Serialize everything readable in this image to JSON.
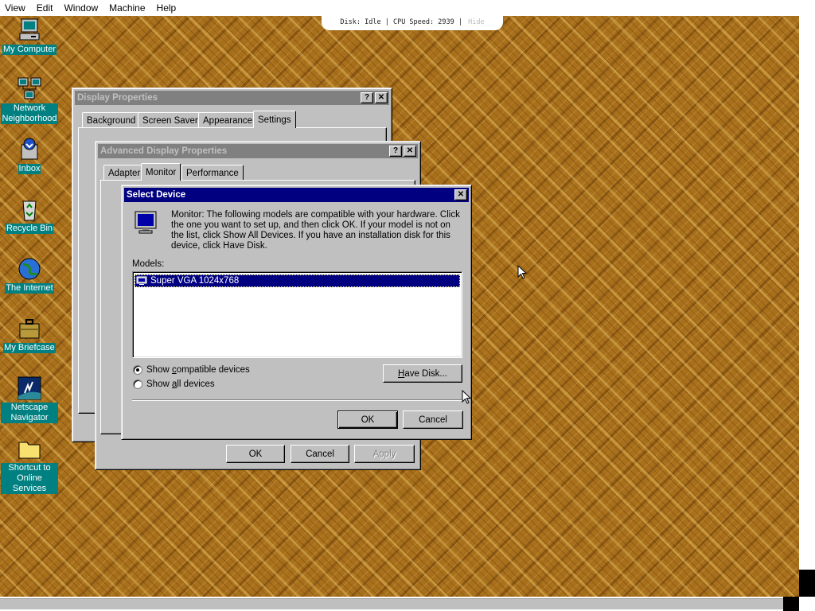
{
  "emulator": {
    "menu": [
      "View",
      "Edit",
      "Window",
      "Machine",
      "Help"
    ],
    "status": {
      "disk_label": "Disk:",
      "disk_value": "Idle",
      "cpu_label": "CPU Speed:",
      "cpu_value": "2939",
      "hide_label": "Hide"
    }
  },
  "desktop_icons": [
    {
      "label": "My Computer",
      "icon": "my-computer-icon"
    },
    {
      "label": "Network Neighborhood",
      "icon": "network-icon"
    },
    {
      "label": "Inbox",
      "icon": "inbox-icon"
    },
    {
      "label": "Recycle Bin",
      "icon": "recycle-bin-icon"
    },
    {
      "label": "The Internet",
      "icon": "internet-icon"
    },
    {
      "label": "My Briefcase",
      "icon": "briefcase-icon"
    },
    {
      "label": "Netscape Navigator",
      "icon": "netscape-icon"
    },
    {
      "label": "Shortcut to Online Services",
      "icon": "folder-icon"
    }
  ],
  "display_properties": {
    "title": "Display Properties",
    "tabs": [
      "Background",
      "Screen Saver",
      "Appearance",
      "Settings"
    ],
    "selected_tab": "Settings"
  },
  "advanced_display": {
    "title": "Advanced Display Properties",
    "tabs": [
      "Adapter",
      "Monitor",
      "Performance"
    ],
    "selected_tab": "Monitor",
    "buttons": {
      "ok": "OK",
      "cancel": "Cancel",
      "apply": "Apply"
    }
  },
  "select_device": {
    "title": "Select Device",
    "description": "Monitor: The following models are compatible with your hardware. Click the one you want to set up, and then click OK. If your model is not on the list, click Show All Devices. If you have an installation disk for this device, click Have Disk.",
    "models_label": "Models:",
    "models": [
      "Super VGA 1024x768"
    ],
    "selected_model": "Super VGA 1024x768",
    "radio_compatible_prefix": "Show ",
    "radio_compatible_u": "c",
    "radio_compatible_rest": "ompatible devices",
    "radio_all_prefix": "Show ",
    "radio_all_u": "a",
    "radio_all_rest": "ll devices",
    "selected_option": "compatible",
    "have_disk_u": "H",
    "have_disk_rest": "ave Disk...",
    "ok": "OK",
    "cancel": "Cancel"
  }
}
